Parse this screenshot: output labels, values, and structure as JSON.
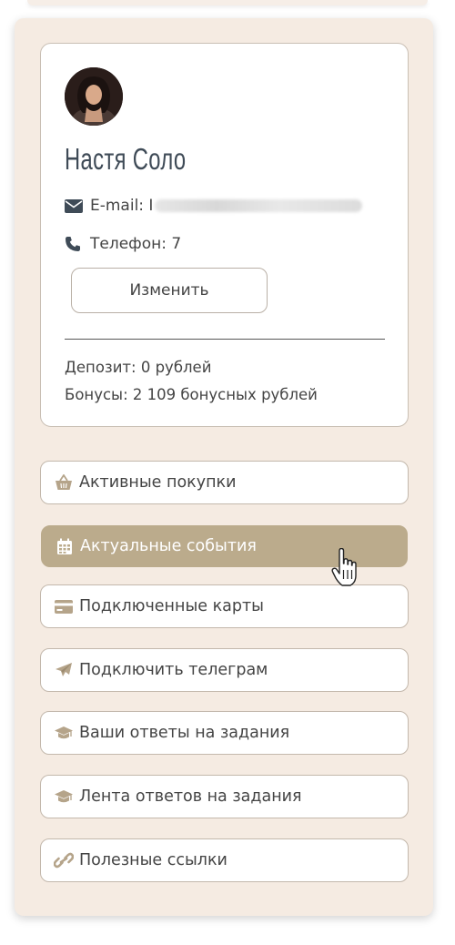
{
  "profile": {
    "name": "Настя Соло",
    "email_label": "E-mail: I",
    "phone_label": "Телефон: 7",
    "edit_button": "Изменить",
    "deposit": "Депозит: 0 рублей",
    "bonuses": "Бонусы: 2 109 бонусных рублей"
  },
  "menu": {
    "items": [
      {
        "label": "Активные покупки",
        "icon": "basket-icon"
      },
      {
        "label": "Актуальные события",
        "icon": "calendar-icon",
        "active": true
      },
      {
        "label": "Подключенные карты",
        "icon": "credit-card-icon"
      },
      {
        "label": "Подключить телеграм",
        "icon": "paper-plane-icon"
      },
      {
        "label": "Ваши ответы на задания",
        "icon": "graduation-cap-icon"
      },
      {
        "label": "Лента ответов на задания",
        "icon": "graduation-cap-icon"
      },
      {
        "label": "Полезные ссылки",
        "icon": "link-icon"
      }
    ]
  },
  "colors": {
    "panel_bg": "#f5ebe2",
    "accent": "#bbab8c",
    "icon": "#b5a48a",
    "name": "#3f4b57"
  }
}
